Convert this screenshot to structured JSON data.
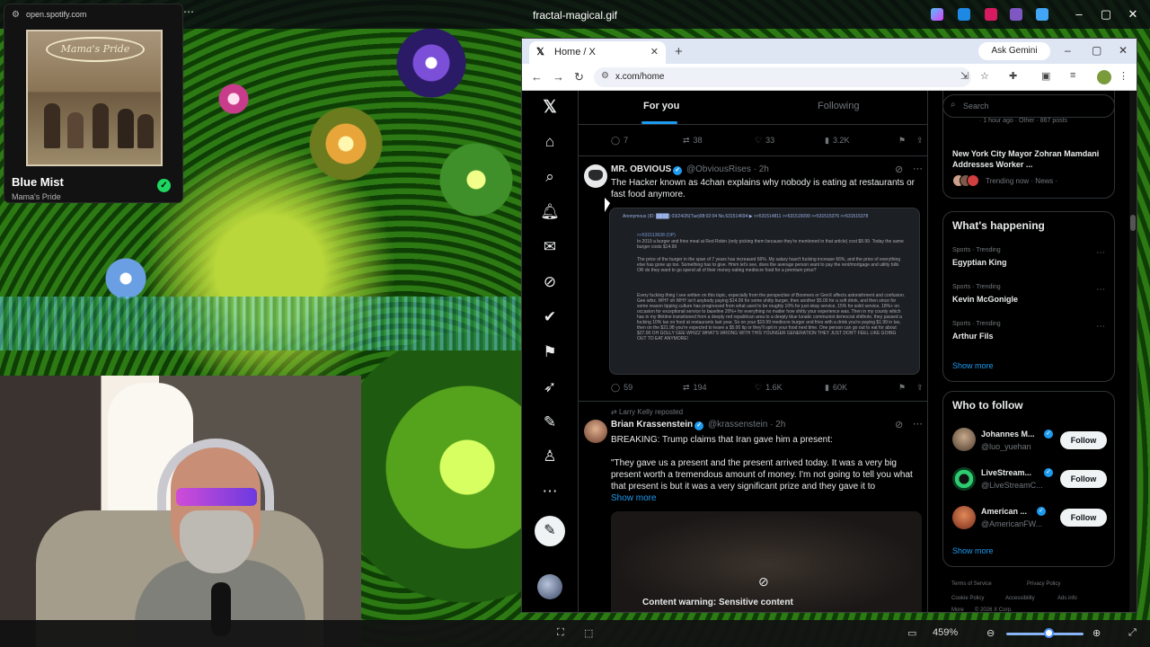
{
  "viewer": {
    "title": "fractal-magical.gif",
    "zoom": "459%",
    "more_icon": "⋯"
  },
  "spotify": {
    "url": "open.spotify.com",
    "album_art_text": "Mama's Pride",
    "track": "Blue Mist",
    "artist": "Mama's Pride"
  },
  "chrome": {
    "tab_title": "Home / X",
    "url": "x.com/home",
    "gemini_label": "Ask Gemini"
  },
  "x": {
    "tabs": {
      "for_you": "For you",
      "following": "Following"
    },
    "prev_actions": {
      "replies": "7",
      "reposts": "38",
      "likes": "33",
      "views": "3.2K"
    },
    "tweet1": {
      "name": "MR. OBVIOUS",
      "handle": "@ObviousRises · 2h",
      "text": "The Hacker known as 4chan explains why nobody is eating at restaurants or fast food anymore.",
      "image_header": "Anonymous (ID: ████) 03/24/26(Tue)08:02:04 No.531514694 ▶ >>531514811 >>531515099 >>531515376 >>531515378",
      "image_quote": ">>531513638 (OP)",
      "image_p1": "In 2019 a burger and fries meal at Red Robin (only picking them because they're mentioned in that article) cost $8.99. Today the same burger costs $14.99",
      "image_p2": "The price of the burger in the span of 7 years has increased 66%. My salary hasn't fucking increase 66%, and the price of everything else has gone up too. Something has to give. Hmm let's see, does the average person want to pay the rent/mortgage and utility bills OR do they want to go spend all of their money eating mediocre food for a premium price?",
      "image_p3": "Every fucking thing I see written on this topic, especially from the perspective of Boomers or GenX affects astonishment and confusion. Gee whiz. WHY oh WHY isn't anybody paying $14.99 for some shitty burger, then another $5.00 for a soft drink, and then since for some reason tipping culture has progressed from what used to be roughly 10% for just-okay service, 15% for solid service, 18%+ on occasion for exceptional service to baseline 20%+ for everything no matter how shitty your experience was. Then in my county which has in my lifetime transitioned from a deeply red republican area to a deeply blue lunatic communist democrat shithole, they passed a fucking 10% tax on food at restaurants last year. So on your $19.99 mediocre burger and fries with a drink you're paying $1.99 in tax, then on the $21.98 you're expected to leave a $5.00 tip or they'll spit in your food next time. One person can go out to eat for about $27.00 OH GOLLY GEE WHIZZ WHAT'S WRONG WITH THIS YOUNGER GENERATION THEY JUST DON'T FEEL LIKE GOING OUT TO EAT ANYMORE!",
      "replies": "59",
      "reposts": "194",
      "likes": "1.6K",
      "views": "60K"
    },
    "tweet2": {
      "repost_by": "Larry Kelly reposted",
      "name": "Brian Krassenstein",
      "handle": "@krassenstein · 2h",
      "text1": "BREAKING:  Trump claims that Iran gave him a present:",
      "text2": "\"They gave us a present and the present arrived today.  It was a very big present worth a tremendous amount of money.  I'm not going to tell you what that present is but it was a very significant prize and they gave it to",
      "show_more": "Show more",
      "sensitive": "Content warning: Sensitive content"
    },
    "search_placeholder": "Search",
    "news": {
      "top_meta": "· 1 hour ago · Other · 867 posts",
      "title": "New York City Mayor Zohran Mamdani Addresses Worker ...",
      "meta": "Trending now · News ·"
    },
    "happening": {
      "title": "What's happening",
      "trends": [
        {
          "meta": "Sports · Trending",
          "name": "Egyptian King"
        },
        {
          "meta": "Sports · Trending",
          "name": "Kevin McGonigle"
        },
        {
          "meta": "Sports · Trending",
          "name": "Arthur Fils"
        }
      ],
      "show_more": "Show more"
    },
    "who_to_follow": {
      "title": "Who to follow",
      "accounts": [
        {
          "name": "Johannes M...",
          "handle": "@luo_yuehan",
          "button": "Follow"
        },
        {
          "name": "LiveStream...",
          "handle": "@LiveStreamC...",
          "button": "Follow"
        },
        {
          "name": "American ...",
          "handle": "@AmericanFW...",
          "button": "Follow"
        }
      ],
      "show_more": "Show more"
    },
    "footer": {
      "terms": "Terms of Service",
      "privacy": "Privacy Policy",
      "cookie": "Cookie Policy",
      "accessibility": "Accessibility",
      "ads": "Ads info",
      "more": "More",
      "copyright": "© 2026 X Corp."
    }
  }
}
